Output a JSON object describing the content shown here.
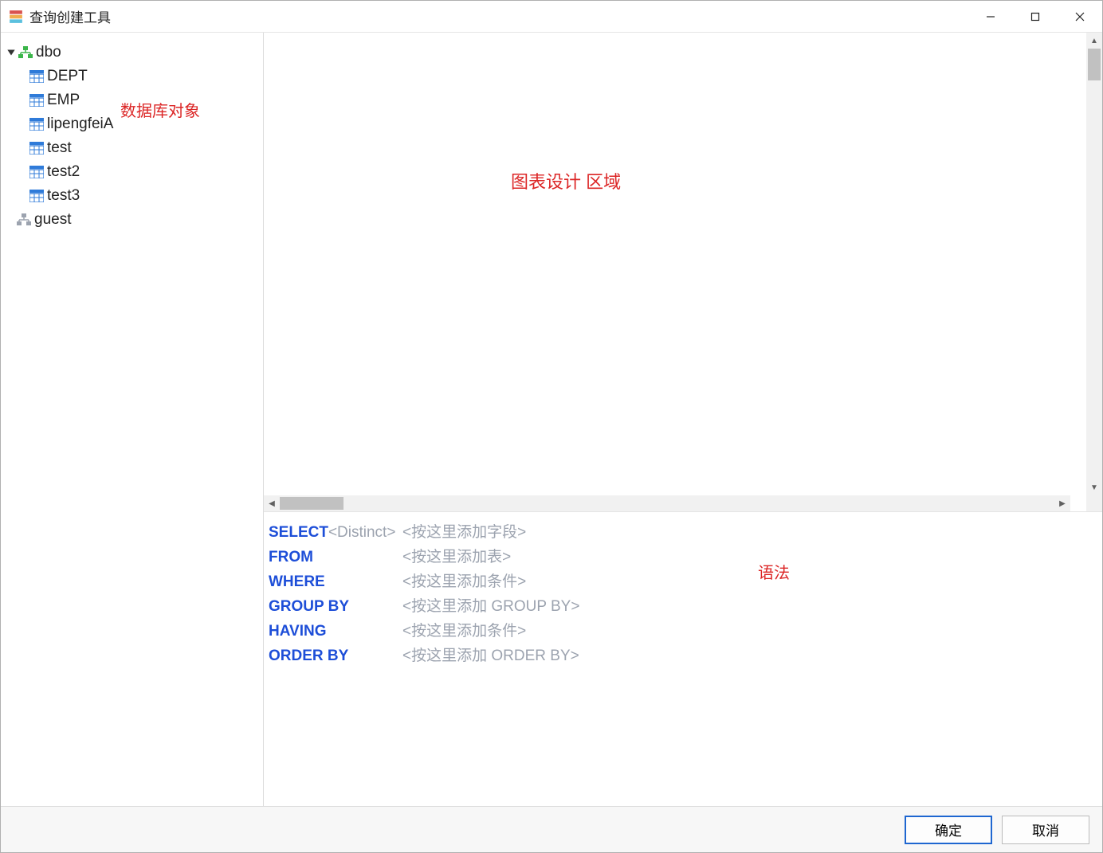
{
  "window": {
    "title": "查询创建工具"
  },
  "sidebar": {
    "annotation": "数据库对象",
    "schemas": [
      {
        "name": "dbo",
        "expanded": true,
        "tables": [
          "DEPT",
          "EMP",
          "lipengfeiA",
          "test",
          "test2",
          "test3"
        ]
      },
      {
        "name": "guest",
        "expanded": false,
        "tables": []
      }
    ]
  },
  "design": {
    "annotation": "图表设计  区域"
  },
  "syntax": {
    "annotation": "语法",
    "clauses": [
      {
        "keyword": "SELECT",
        "suffix": "<Distinct>",
        "placeholder": "<按这里添加字段>"
      },
      {
        "keyword": "FROM",
        "suffix": "",
        "placeholder": "<按这里添加表>"
      },
      {
        "keyword": "WHERE",
        "suffix": "",
        "placeholder": "<按这里添加条件>"
      },
      {
        "keyword": "GROUP BY",
        "suffix": "",
        "placeholder": "<按这里添加 GROUP BY>"
      },
      {
        "keyword": "HAVING",
        "suffix": "",
        "placeholder": "<按这里添加条件>"
      },
      {
        "keyword": "ORDER BY",
        "suffix": "",
        "placeholder": "<按这里添加 ORDER BY>"
      }
    ]
  },
  "footer": {
    "ok": "确定",
    "cancel": "取消"
  }
}
